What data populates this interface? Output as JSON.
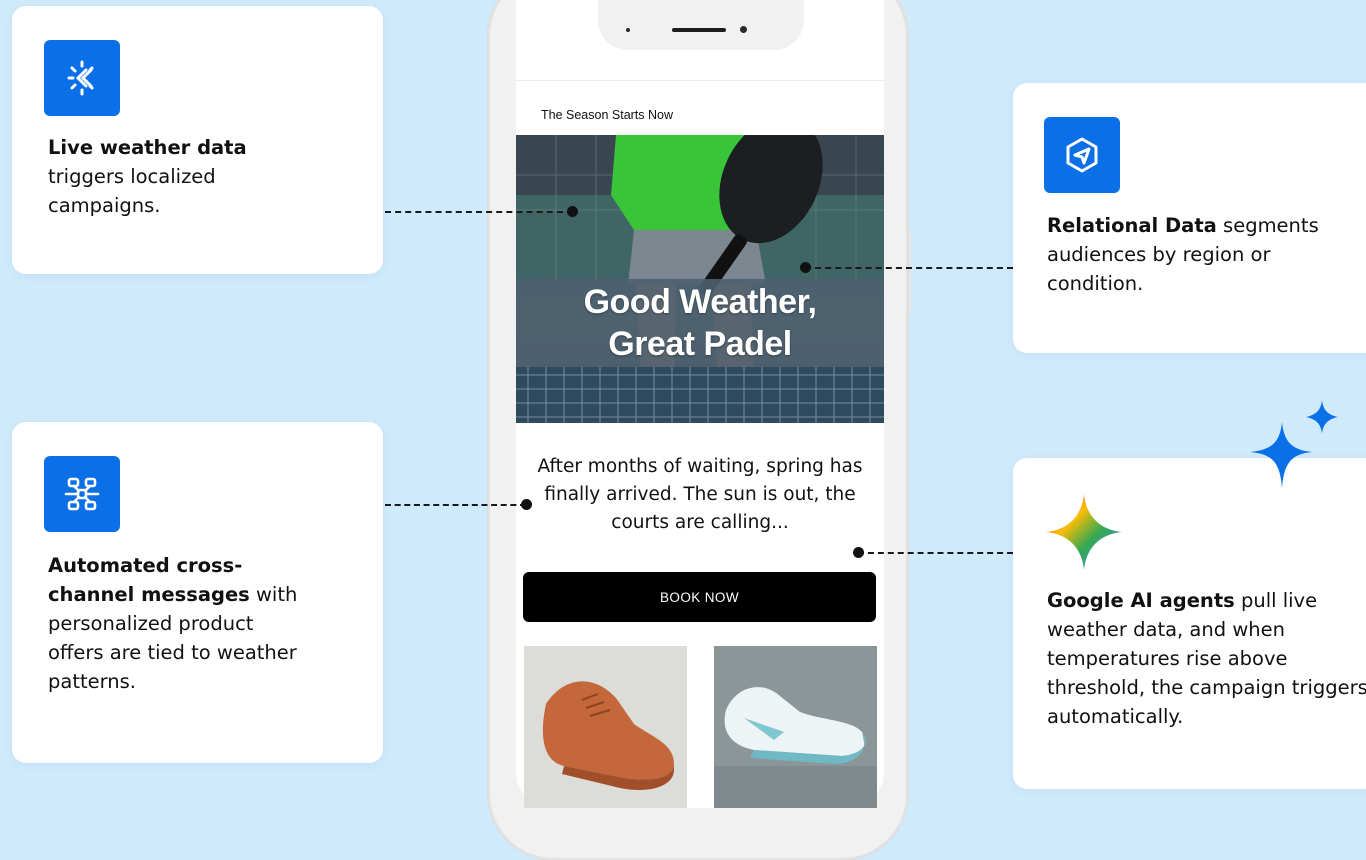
{
  "cards": {
    "weather": {
      "bold": "Live weather data",
      "rest": "triggers localized campaigns."
    },
    "automated": {
      "bold": "Automated cross-channel messages",
      "rest": "with personalized product offers are tied to weather patterns."
    },
    "relational": {
      "bold": "Relational Data",
      "rest": "segments audiences by region or condition."
    },
    "google": {
      "bold": "Google AI agents",
      "rest": "pull live weather data, and when temperatures rise above threshold, the campaign triggers automatically."
    }
  },
  "email": {
    "kicker": "The Season Starts Now",
    "hero_title": "Good Weather,\nGreat Padel",
    "body": "After months of waiting, spring has finally arrived. The sun is out, the courts are calling...",
    "cta": "BOOK NOW"
  },
  "colors": {
    "accent": "#0b6fe8",
    "background": "#cfeafb"
  },
  "icons": [
    "weather-sun-icon",
    "network-nodes-icon",
    "relational-data-icon",
    "google-gemini-sparkle-icon",
    "decorative-sparkle-icon"
  ]
}
